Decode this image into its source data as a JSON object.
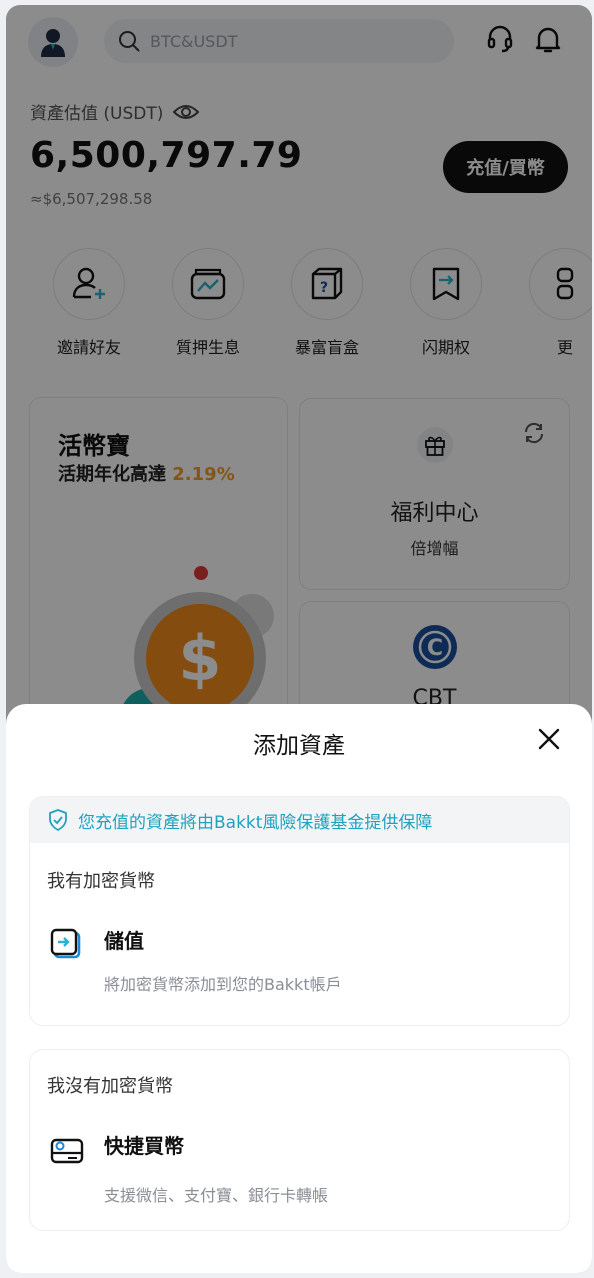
{
  "header": {
    "search_placeholder": "BTC&USDT",
    "icons": [
      "avatar-icon",
      "search-icon",
      "headset-icon",
      "bell-icon"
    ]
  },
  "assets": {
    "label": "資產估值 (USDT)",
    "value": "6,500,797.79",
    "fiat": "≈$6,507,298.58",
    "deposit_button": "充值/買幣"
  },
  "shortcuts": [
    {
      "label": "邀請好友",
      "icon": "invite-user-icon"
    },
    {
      "label": "質押生息",
      "icon": "staking-icon"
    },
    {
      "label": "暴富盲盒",
      "icon": "mystery-box-icon"
    },
    {
      "label": "闪期权",
      "icon": "flash-option-icon"
    },
    {
      "label": "更",
      "icon": "more-icon"
    }
  ],
  "cards": {
    "flexible": {
      "title": "活幣寶",
      "subtitle": "活期年化高達",
      "rate": "2.19%"
    },
    "welfare": {
      "title": "福利中心",
      "subtitle": "倍增幅"
    },
    "cbt": {
      "title": "CBT"
    }
  },
  "sheet": {
    "title": "添加資產",
    "notice": "您充值的資產將由Bakkt風險保護基金提供保障",
    "have_crypto": {
      "section": "我有加密貨幣",
      "option_title": "儲值",
      "option_desc": "將加密貨幣添加到您的Bakkt帳戶"
    },
    "no_crypto": {
      "section": "我沒有加密貨幣",
      "option_title": "快捷買幣",
      "option_desc": "支援微信、支付寶、銀行卡轉帳"
    }
  },
  "colors": {
    "accent": "#1ea2c0",
    "rate": "#f29c2b",
    "coin": "#f28a1e",
    "cbt": "#1a4fa0"
  }
}
